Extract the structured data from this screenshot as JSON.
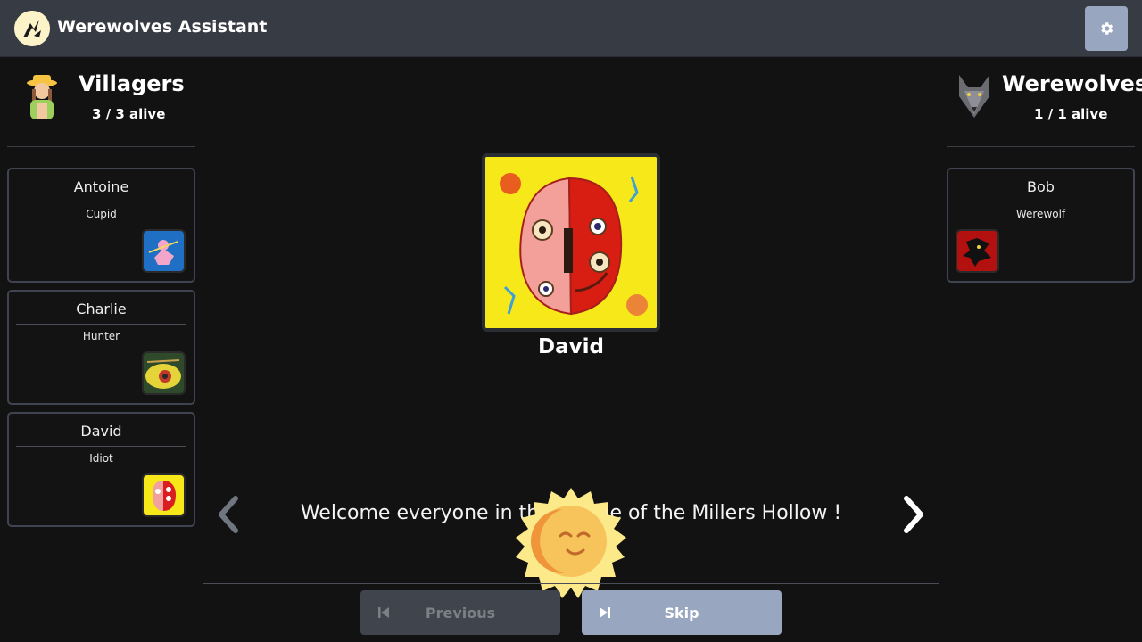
{
  "app": {
    "title": "Werewolves Assistant"
  },
  "teams": {
    "villagers": {
      "name": "Villagers",
      "count": "3 / 3 alive",
      "players": [
        {
          "name": "Antoine",
          "role": "Cupid"
        },
        {
          "name": "Charlie",
          "role": "Hunter"
        },
        {
          "name": "David",
          "role": "Idiot"
        }
      ]
    },
    "werewolves": {
      "name": "Werewolves",
      "count": "1 / 1 alive",
      "players": [
        {
          "name": "Bob",
          "role": "Werewolf"
        }
      ]
    }
  },
  "current_player": {
    "name": "David"
  },
  "narration": {
    "text": "Welcome everyone in the village of the Millers Hollow !"
  },
  "controls": {
    "previous_label": "Previous",
    "skip_label": "Skip"
  },
  "icons": {
    "settings": "gear-icon",
    "prev": "chevron-left-icon",
    "next": "chevron-right-icon",
    "day": "sun-icon"
  },
  "colors": {
    "header": "#373b43",
    "accent": "#98a6bf",
    "background": "#121212"
  }
}
